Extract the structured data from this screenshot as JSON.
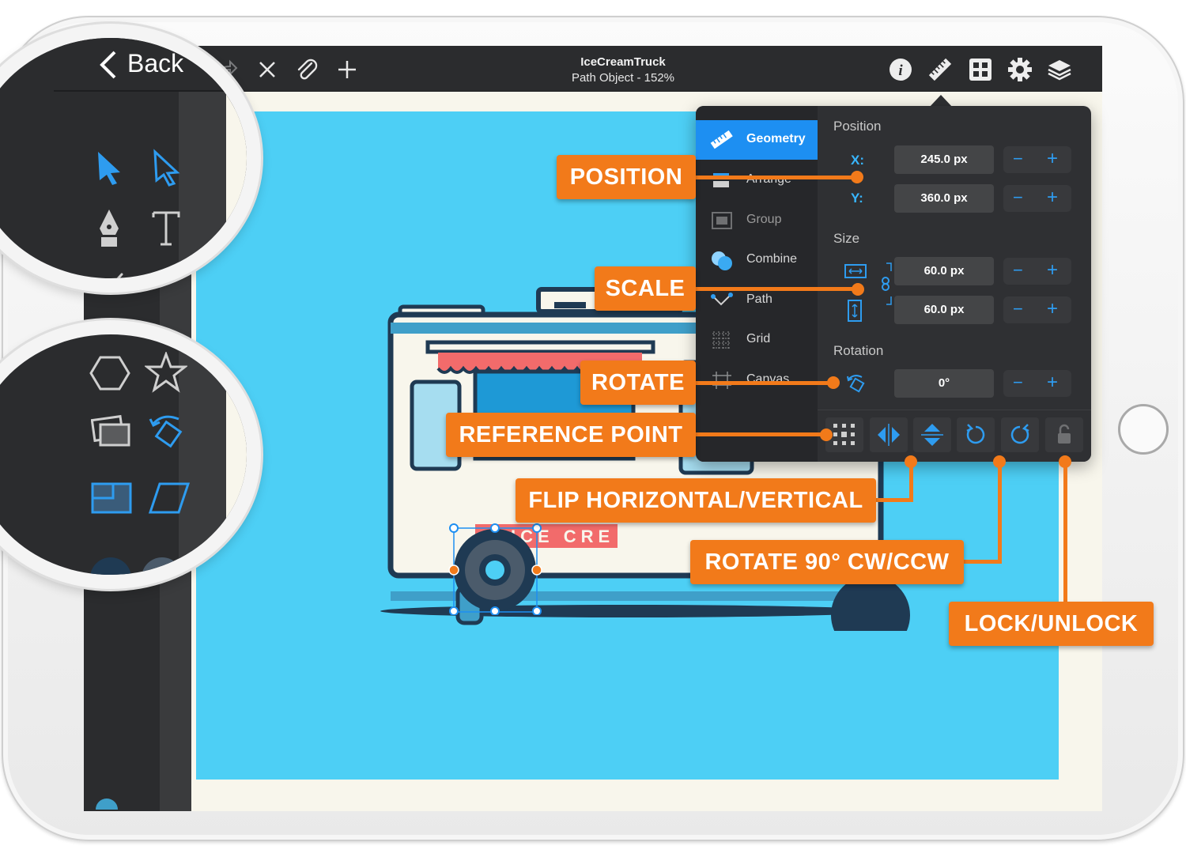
{
  "toolbar": {
    "back_label": "Back",
    "title": "IceCreamTruck",
    "subtitle": "Path Object - 152%",
    "icons": [
      "redo-icon",
      "close-icon",
      "paperclip-icon",
      "plus-icon",
      "info-icon",
      "ruler-icon",
      "grid-icon",
      "gear-icon",
      "layers-icon"
    ]
  },
  "panel": {
    "tabs": [
      {
        "label": "Geometry",
        "icon": "ruler-icon",
        "active": true
      },
      {
        "label": "Arrange",
        "icon": "arrange-icon"
      },
      {
        "label": "Group",
        "icon": "group-icon"
      },
      {
        "label": "Combine",
        "icon": "combine-icon"
      },
      {
        "label": "Path",
        "icon": "path-icon"
      },
      {
        "label": "Grid",
        "icon": "grid-icon"
      },
      {
        "label": "Canvas",
        "icon": "canvas-icon"
      }
    ],
    "position_label": "Position",
    "x_label": "X:",
    "x_value": "245.0 px",
    "y_label": "Y:",
    "y_value": "360.0 px",
    "size_label": "Size",
    "width_value": "60.0 px",
    "height_value": "60.0 px",
    "rotation_label": "Rotation",
    "rotation_value": "0°",
    "stepper_minus": "−",
    "stepper_plus": "+"
  },
  "artwork": {
    "truck_text": "ICE CRE"
  },
  "callouts": {
    "position": "POSITION",
    "scale": "SCALE",
    "rotate": "ROTATE",
    "reference_point": "REFERENCE POINT",
    "flip": "FLIP HORIZONTAL/VERTICAL",
    "rotate90": "ROTATE 90° CW/CCW",
    "lock": "LOCK/UNLOCK"
  },
  "colors": {
    "accent": "#1d8ff2",
    "callout": "#f27a1a",
    "canvas": "#4dcff5"
  }
}
